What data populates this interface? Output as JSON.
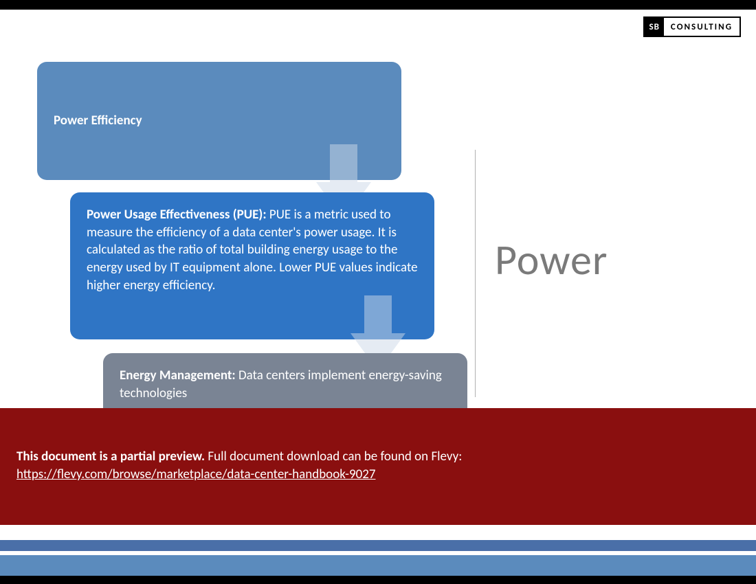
{
  "logo": {
    "sb": "SB",
    "consulting": "CONSULTING"
  },
  "box1": {
    "title": "Power Efficiency"
  },
  "box2": {
    "title": "Power Usage Effectiveness (PUE): ",
    "body": "PUE is a metric used to measure the efficiency of a data center's power usage. It is calculated as the ratio of total building energy usage to the energy used by IT equipment alone. Lower PUE values indicate higher energy efficiency."
  },
  "box3": {
    "title": "Energy Management: ",
    "body": "Data centers implement energy-saving technologies"
  },
  "section_label": "Power",
  "banner": {
    "bold": "This document is a partial preview.",
    "rest": "  Full document download can be found on Flevy:",
    "url": "https://flevy.com/browse/marketplace/data-center-handbook-9027"
  }
}
